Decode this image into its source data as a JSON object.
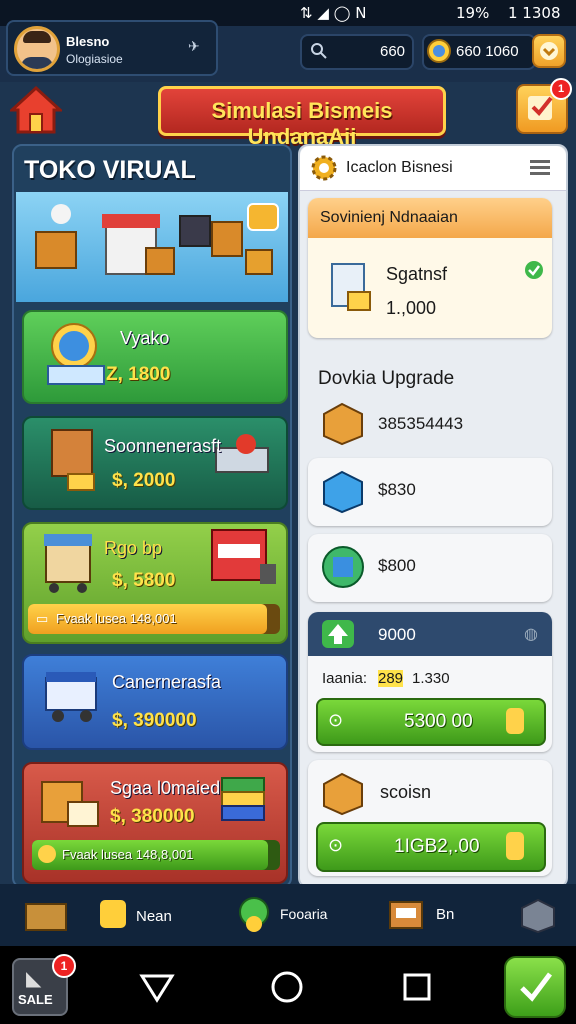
{
  "status_bar": {
    "left_icons": "⇅ ◢ ◯ N",
    "battery": "19%",
    "clock": "1 1308"
  },
  "profile": {
    "name": "Blesno",
    "subtitle": "Ologiasioe"
  },
  "resources": {
    "search_value": "660",
    "coins_value": "660 1060"
  },
  "title_banner": "Simulasi Bismeis UndanaAii",
  "notification_count": "1",
  "left_panel": {
    "title": "TOKO VIRUAL",
    "shops": [
      {
        "name": "Vyako",
        "price": "Z, 1800",
        "color": "#3fb04a"
      },
      {
        "name": "Soonnenerasft",
        "price": "$, 2000",
        "color": "#1f7d5c"
      },
      {
        "name": "Rgo bp",
        "price": "$, 5800",
        "color": "#7fbf3a",
        "progress_text": "Fvaak lusea 148,001",
        "progress": 0.95
      },
      {
        "name": "Canernerasfa",
        "price": "$, 390000",
        "color": "#2e62b8"
      },
      {
        "name": "Sgaa l0maied",
        "price": "$, 380000",
        "color": "#c2443a",
        "progress_text": "Fvaak lusea 148,8,001",
        "progress": 0.95
      }
    ]
  },
  "right_panel": {
    "header": "Icaclon Bisnesi",
    "featured": {
      "title": "Sovinienj Ndnaaian",
      "item_name": "Sgatnsf",
      "item_value": "1.,000"
    },
    "upgrade_title": "Dovkia Upgrade",
    "upgrades": [
      {
        "value": "385354443",
        "icon": "box-icon"
      },
      {
        "value": "$830",
        "icon": "cube-icon"
      },
      {
        "value": "$800",
        "icon": "crate-icon"
      }
    ],
    "upgrade_card": {
      "level": "9000",
      "detail_label": "Iaania:",
      "detail_highlight": "289",
      "detail_value": "1.330",
      "button": "5300 00"
    },
    "bottom_card": {
      "label": "scoisn",
      "button": "1IGB2,.00"
    }
  },
  "bottom_nav": [
    {
      "label": "",
      "icon": "map-icon"
    },
    {
      "label": "Nean",
      "icon": "money-icon"
    },
    {
      "label": "Fooaria",
      "icon": "character-icon"
    },
    {
      "label": "Bn",
      "icon": "register-icon"
    },
    {
      "label": "",
      "icon": "package-icon"
    }
  ],
  "sale_button": {
    "label": "SALE",
    "badge": "1"
  },
  "colors": {
    "accent_green": "#5cbf2a",
    "accent_gold": "#ffd24a",
    "banner_red": "#c92e25"
  }
}
